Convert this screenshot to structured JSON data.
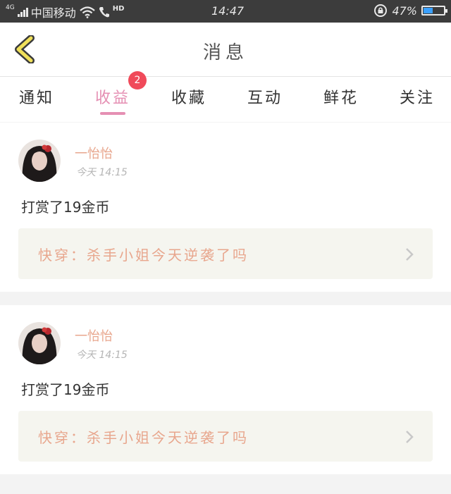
{
  "status_bar": {
    "network_type": "4G",
    "carrier": "中国移动",
    "hd_label": "HD",
    "time": "14:47",
    "battery_percent": "47%",
    "battery_level": 0.47
  },
  "header": {
    "title": "消息",
    "back_icon": "chevron-left-icon"
  },
  "tabs": [
    {
      "label": "通知"
    },
    {
      "label": "收益",
      "badge": "2",
      "active": true
    },
    {
      "label": "收藏"
    },
    {
      "label": "互动"
    },
    {
      "label": "鲜花"
    },
    {
      "label": "关注"
    }
  ],
  "messages": [
    {
      "username": "一怡怡",
      "time": "今天 14:15",
      "action": "打赏了19金币",
      "book_link": "快穿：杀手小姐今天逆袭了吗"
    },
    {
      "username": "一怡怡",
      "time": "今天 14:15",
      "action": "打赏了19金币",
      "book_link": "快穿：杀手小姐今天逆袭了吗"
    }
  ],
  "colors": {
    "accent_pink": "#e58fb3",
    "badge_red": "#f04a5a",
    "username_peach": "#e8a68d",
    "back_arrow_yellow": "#f0e05a"
  }
}
